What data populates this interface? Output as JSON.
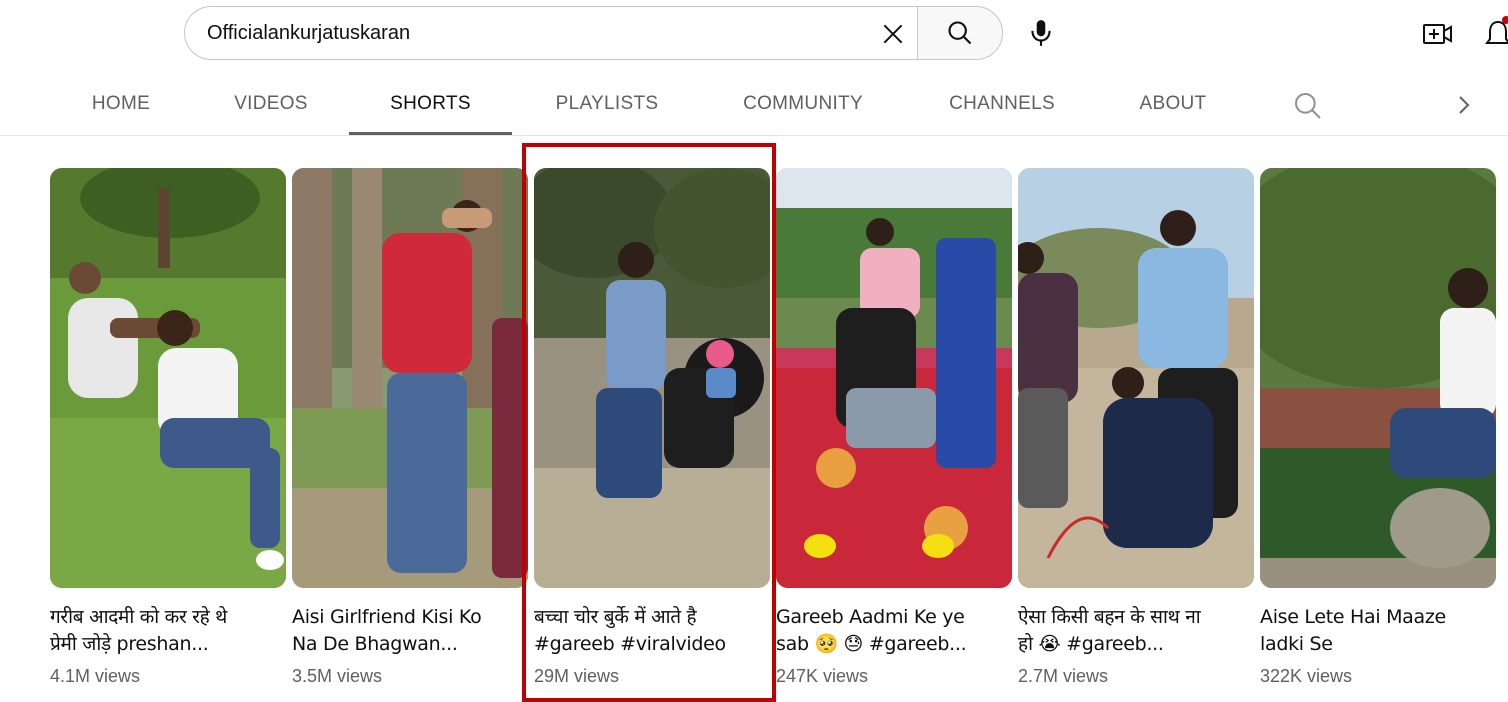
{
  "search": {
    "value": "Officialankurjatuskaran",
    "placeholder": "Search"
  },
  "icons": {
    "clear": "close-icon",
    "search": "search-icon",
    "mic": "microphone-icon",
    "create": "video-add-icon",
    "notifications": "bell-icon",
    "next": "chevron-right-icon"
  },
  "tabs": [
    {
      "label": "HOME"
    },
    {
      "label": "VIDEOS"
    },
    {
      "label": "SHORTS",
      "active": true
    },
    {
      "label": "PLAYLISTS"
    },
    {
      "label": "COMMUNITY"
    },
    {
      "label": "CHANNELS"
    },
    {
      "label": "ABOUT"
    }
  ],
  "shorts": [
    {
      "title_line1": "गरीब आदमी को कर रहे थे",
      "title_line2": "प्रेमी जोड़े preshan...",
      "views": "4.1M views"
    },
    {
      "title_line1": "Aisi Girlfriend Kisi Ko",
      "title_line2": "Na De Bhagwan...",
      "views": "3.5M views"
    },
    {
      "title_line1": "बच्चा चोर बुर्के में आते है",
      "title_line2": "#gareeb #viralvideo",
      "views": "29M views"
    },
    {
      "title_line1": "Gareeb Aadmi Ke ye",
      "title_line2": "sab 🥺 😓 #gareeb...",
      "views": "247K views"
    },
    {
      "title_line1": "ऐसा किसी बहन के साथ ना",
      "title_line2": "हो 😭 #gareeb...",
      "views": "2.7M views"
    },
    {
      "title_line1": "Aise Lete Hai Maaze",
      "title_line2": "ladki Se",
      "views": "322K views"
    }
  ],
  "colors": {
    "highlight": "#c00000",
    "secondary_text": "#606060",
    "notification_dot": "#cc0000"
  }
}
